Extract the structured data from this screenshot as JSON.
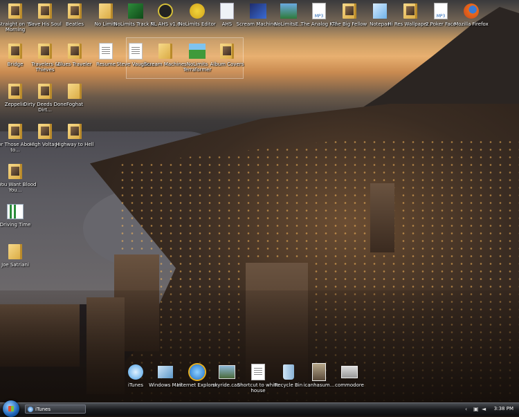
{
  "desktop": {
    "icons": [
      {
        "label": "Straight on 'til Morning",
        "kind": "folder"
      },
      {
        "label": "Save His Soul",
        "kind": "folder"
      },
      {
        "label": "Beatles",
        "kind": "folder"
      },
      {
        "label": "No Limits",
        "kind": "folder"
      },
      {
        "label": "NoLimits Track P...",
        "kind": "app"
      },
      {
        "label": "NL AHS v1.6",
        "kind": "app"
      },
      {
        "label": "NoLimits Editor",
        "kind": "app"
      },
      {
        "label": "AHS",
        "kind": "app"
      },
      {
        "label": "Scream Machine -",
        "kind": "app"
      },
      {
        "label": "NoLimitsE...",
        "kind": "app"
      },
      {
        "label": "The Analog Kid",
        "kind": "mp3"
      },
      {
        "label": "The Big Fellow",
        "kind": "folder"
      },
      {
        "label": "Notepad",
        "kind": "app"
      },
      {
        "label": "Hi Res Wallpaper...",
        "kind": "folder"
      },
      {
        "label": "2 Poker Face",
        "kind": "mp3"
      },
      {
        "label": "Mozilla Firefox",
        "kind": "app"
      },
      {
        "label": "Bridge",
        "kind": "folder"
      },
      {
        "label": "Travelers & Thieves",
        "kind": "folder"
      },
      {
        "label": "Blues Traveler",
        "kind": "folder"
      },
      {
        "label": "Resume",
        "kind": "doc"
      },
      {
        "label": "Steve Vaughn...",
        "kind": "doc"
      },
      {
        "label": "Scream Machines",
        "kind": "folder"
      },
      {
        "label": "NoLimits Terraformer",
        "kind": "app"
      },
      {
        "label": "Album Covers",
        "kind": "folder"
      },
      {
        "label": "Zeppelin",
        "kind": "folder"
      },
      {
        "label": "Dirty Deeds Done Dirt...",
        "kind": "folder"
      },
      {
        "label": "Foghat",
        "kind": "folder"
      },
      {
        "label": "For Those About to...",
        "kind": "folder"
      },
      {
        "label": "High Voltage",
        "kind": "folder"
      },
      {
        "label": "Highway to Hell",
        "kind": "folder"
      },
      {
        "label": "If You Want Blood You...",
        "kind": "folder"
      },
      {
        "label": "Driving Time",
        "kind": "doc"
      },
      {
        "label": "Joe Satriani",
        "kind": "folder"
      },
      {
        "label": "iTunes",
        "kind": "app"
      },
      {
        "label": "Windows Mail",
        "kind": "app"
      },
      {
        "label": "Internet Explorer",
        "kind": "app"
      },
      {
        "label": "skyride.cam",
        "kind": "doc"
      },
      {
        "label": "Shortcut to white house",
        "kind": "doc"
      },
      {
        "label": "Recycle Bin",
        "kind": "app"
      },
      {
        "label": "icanhasum...",
        "kind": "doc"
      },
      {
        "label": "commodore",
        "kind": "doc"
      }
    ]
  },
  "taskbar": {
    "start_label": "Start",
    "running_app": "iTunes",
    "clock": "3:38 PM"
  }
}
